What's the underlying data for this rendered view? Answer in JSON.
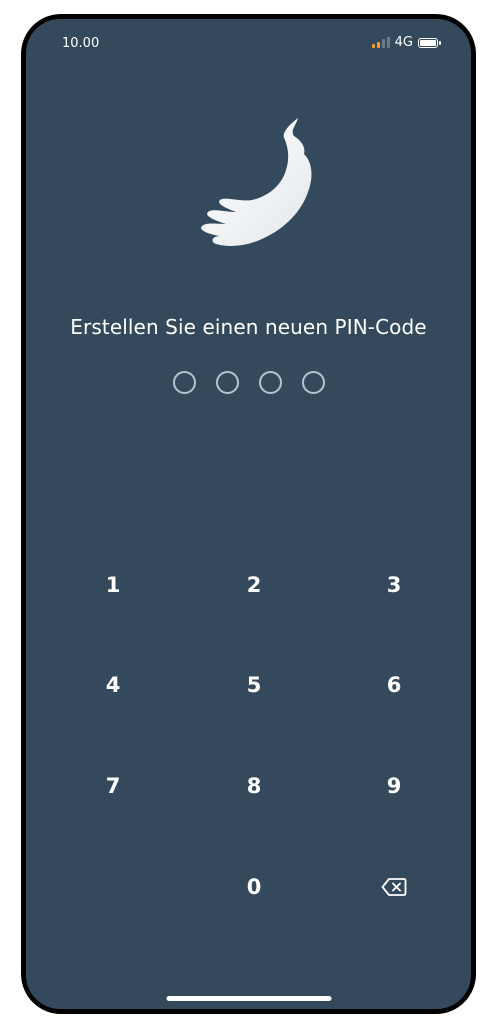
{
  "status_bar": {
    "time": "10.00",
    "network": "4G",
    "signal_icon": "signal-bars-icon",
    "battery_icon": "battery-icon"
  },
  "app": {
    "logo_icon": "brush-stroke-logo-icon",
    "title": "Erstellen Sie einen neuen PIN-Code",
    "pin_length": 4,
    "pin_entered": 0
  },
  "keypad": {
    "keys": [
      "1",
      "2",
      "3",
      "4",
      "5",
      "6",
      "7",
      "8",
      "9",
      "0"
    ],
    "backspace_icon": "backspace-icon"
  },
  "colors": {
    "background": "#35495c",
    "text": "#ffffff",
    "pin_dot_border": "#b8c2cc",
    "signal_active": "#ff9a2a"
  }
}
